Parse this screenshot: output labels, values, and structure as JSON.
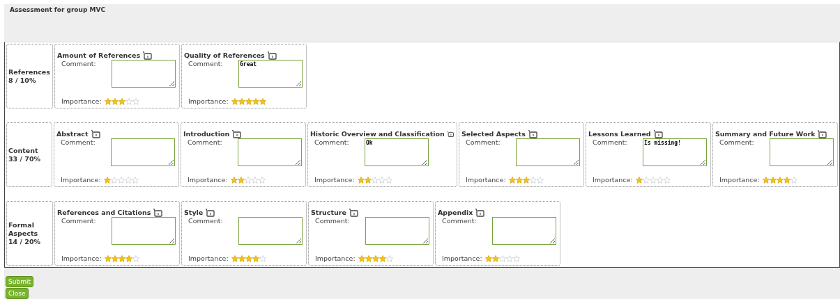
{
  "header": {
    "title": "Assessment for group MVC"
  },
  "groups": [
    {
      "name": "References",
      "score": "8 / 10%",
      "criteria": [
        {
          "title": "Amount of References",
          "comment_label": "Comment:",
          "importance_label": "Importance:",
          "stars": 3
        },
        {
          "title": "Quality of References",
          "comment_label": "Comment:",
          "comment": "Great",
          "importance_label": "Importance:",
          "stars": 5
        }
      ]
    },
    {
      "name": "Content",
      "score": "33 / 70%",
      "criteria": [
        {
          "title": "Abstract",
          "comment_label": "Comment:",
          "importance_label": "Importance:",
          "stars": 1
        },
        {
          "title": "Introduction",
          "comment_label": "Comment:",
          "importance_label": "Importance:",
          "stars": 2
        },
        {
          "title": "Historic Overview and Classification",
          "comment_label": "Comment:",
          "comment": "Ok",
          "importance_label": "Importance:",
          "stars": 2
        },
        {
          "title": "Selected Aspects",
          "comment_label": "Comment:",
          "importance_label": "Importance:",
          "stars": 3
        },
        {
          "title": "Lessons Learned",
          "comment_label": "Comment:",
          "comment": "Is missing!",
          "importance_label": "Importance:",
          "stars": 1
        },
        {
          "title": "Summary and Future Work",
          "comment_label": "Comment:",
          "importance_label": "Importance:",
          "stars": 4
        }
      ]
    },
    {
      "name": "Formal Aspects",
      "score": "14 / 20%",
      "criteria": [
        {
          "title": "References and Citations",
          "comment_label": "Comment:",
          "importance_label": "Importance:",
          "stars": 4
        },
        {
          "title": "Style",
          "comment_label": "Comment:",
          "importance_label": "Importance:",
          "stars": 4
        },
        {
          "title": "Structure",
          "comment_label": "Comment:",
          "importance_label": "Importance:",
          "stars": 4
        },
        {
          "title": "Appendix",
          "comment_label": "Comment:",
          "importance_label": "Importance:",
          "stars": 2
        }
      ]
    }
  ],
  "buttons": [
    {
      "label": "Submit"
    },
    {
      "label": "Close"
    }
  ]
}
